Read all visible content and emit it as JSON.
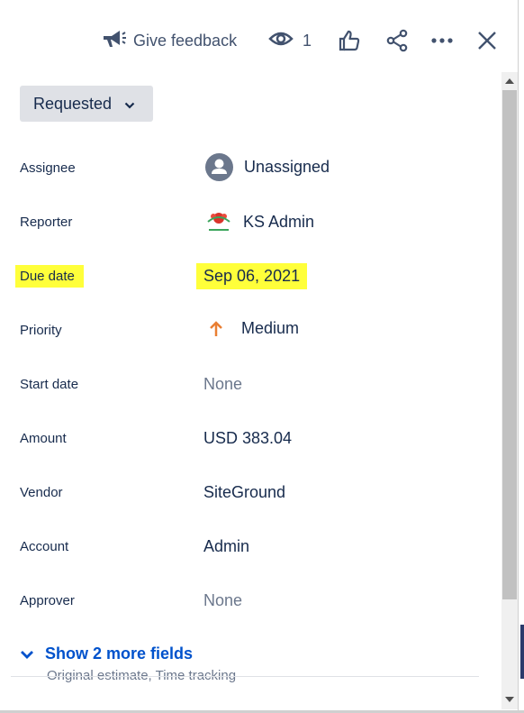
{
  "toolbar": {
    "feedback_label": "Give feedback",
    "watch_count": "1",
    "icons": [
      "megaphone-icon",
      "eye-icon",
      "thumbs-up-icon",
      "share-icon",
      "more-icon",
      "close-icon"
    ]
  },
  "status": {
    "label": "Requested"
  },
  "fields": [
    {
      "label": "Assignee",
      "value": "Unassigned",
      "icon": "avatar-icon"
    },
    {
      "label": "Reporter",
      "value": "KS Admin",
      "icon": "ks-admin-avatar"
    },
    {
      "label": "Due date",
      "value": "Sep 06, 2021",
      "highlighted": true
    },
    {
      "label": "Priority",
      "value": "Medium",
      "icon": "priority-up-arrow-icon",
      "icon_color": "#E97F33"
    },
    {
      "label": "Start date",
      "value": "None",
      "muted": true
    },
    {
      "label": "Amount",
      "value": "USD 383.04"
    },
    {
      "label": "Vendor",
      "value": "SiteGround"
    },
    {
      "label": "Account",
      "value": "Admin"
    },
    {
      "label": "Approver",
      "value": "None",
      "muted": true
    }
  ],
  "more": {
    "label": "Show 2 more fields",
    "subtitle": "Original estimate, Time tracking"
  },
  "colors": {
    "text": "#172B4D",
    "muted": "#6B778C",
    "link": "#0052CC",
    "highlight": "#FFFF3A",
    "status_bg": "#DFE1E6"
  }
}
